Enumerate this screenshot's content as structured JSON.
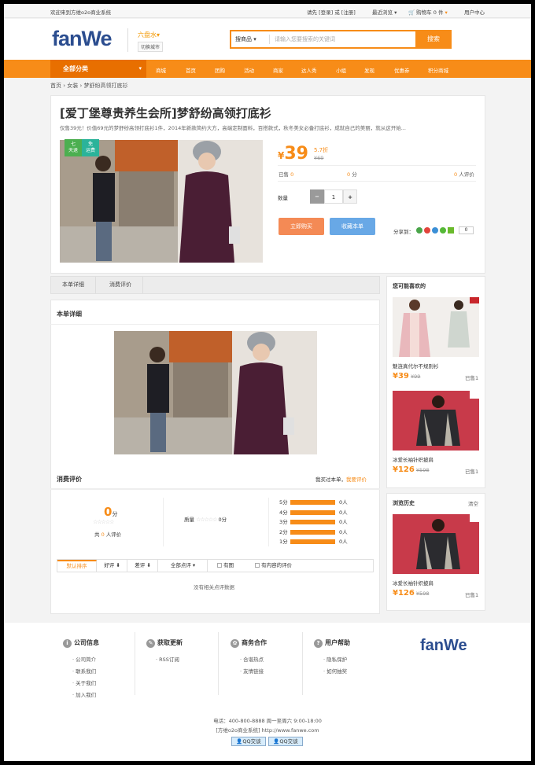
{
  "topbar": {
    "welcome": "欢迎来到方维o2o商业系统",
    "login_text": "请先 [登录] 或 [注册]",
    "recent": "最近浏览",
    "cart": "购物车 0 件",
    "user_center": "用户中心"
  },
  "header": {
    "logo": "fanWe",
    "city": "六盘水",
    "switch_city": "切换城市",
    "search_category": "搜商品",
    "search_placeholder": "请输入您要搜索的关键词",
    "search_button": "搜索"
  },
  "nav": {
    "all_categories": "全部分类",
    "items": [
      "商城",
      "首页",
      "团购",
      "活动",
      "商家",
      "达人秀",
      "小组",
      "发现",
      "优惠券",
      "积分商城"
    ]
  },
  "breadcrumb": [
    "首页",
    "女装",
    "梦舒纷高领打底衫"
  ],
  "product": {
    "title": "[爱丁堡尊贵养生会所]梦舒纷高领打底衫",
    "description": "仅售39元！价值69元的梦舒纷高领打底衫1件，2014年新款简约大方，高端定制面料，百搭款式，秋冬美女必备打底衫，成就自己的美丽，就从这开始...",
    "tag_days_top": "七",
    "tag_days_bottom": "天退",
    "tag_ship_top": "免",
    "tag_ship_bottom": "运费",
    "currency": "¥",
    "price": "39",
    "discount": "5.7折",
    "original_price": "¥69",
    "sold_label": "已售",
    "sold": "0",
    "score": "0",
    "score_unit": "分",
    "reviews": "0",
    "reviews_label": "人评价",
    "qty_label": "数量",
    "qty": "1",
    "buy_button": "立即购买",
    "fav_button": "收藏本单",
    "share_label": "分享到：",
    "share_count": "0"
  },
  "tabs": [
    "本单详细",
    "消费评价"
  ],
  "detail_title": "本单详细",
  "reviews_section": {
    "title": "消费评价",
    "buy_prompt": "我买过本单，",
    "review_link": "我要评价",
    "score": "0",
    "score_unit": "分",
    "count_text_pre": "共",
    "count": "0",
    "count_text_post": "人评价",
    "quality_label": "质量",
    "quality_score": "0分",
    "distribution": [
      {
        "label": "5分",
        "count": "0人",
        "ratio": 1
      },
      {
        "label": "4分",
        "count": "0人",
        "ratio": 1
      },
      {
        "label": "3分",
        "count": "0人",
        "ratio": 1
      },
      {
        "label": "2分",
        "count": "0人",
        "ratio": 1
      },
      {
        "label": "1分",
        "count": "0人",
        "ratio": 1
      }
    ],
    "filters": [
      "默认排序",
      "好评",
      "差评",
      "全部点评",
      "有图",
      "有内容的评价"
    ],
    "empty": "没有相关点评数据"
  },
  "sidebar": {
    "recommend_title": "您可能喜欢的",
    "recommend": [
      {
        "name": "魅涟真代尔不规则衫",
        "price": "39",
        "orig": "¥99",
        "sold": "已售1"
      },
      {
        "name": "冰爱长袖针织披肩",
        "price": "126",
        "orig": "¥598",
        "sold": "已售1"
      }
    ],
    "history_title": "浏览历史",
    "history_clear": "清空",
    "history": [
      {
        "name": "冰爱长袖针织披肩",
        "price": "126",
        "orig": "¥598",
        "sold": "已售1"
      }
    ]
  },
  "footer": {
    "cols": [
      {
        "title": "公司信息",
        "links": [
          "公司简介",
          "联系我们",
          "关于我们",
          "加入我们"
        ]
      },
      {
        "title": "获取更新",
        "links": [
          "RSS订阅"
        ]
      },
      {
        "title": "商务合作",
        "links": [
          "合谐热点",
          "友情链接"
        ]
      },
      {
        "title": "用户帮助",
        "links": [
          "隐私保护",
          "如何抽奖"
        ]
      }
    ],
    "logo": "fanWe",
    "phone": "电话：400-800-8888 周一至周六 9:00-18:00",
    "site": "[方维o2o商业系统] http://www.fanwe.com",
    "qq1": "QQ交谈",
    "qq2": "QQ交谈"
  },
  "colors": {
    "accent": "#f78c18",
    "nav_dark": "#e86f00",
    "buy": "#f48a55",
    "fav": "#68a8e6",
    "tag_green": "#4caf50",
    "tag_teal": "#2bb39a"
  }
}
